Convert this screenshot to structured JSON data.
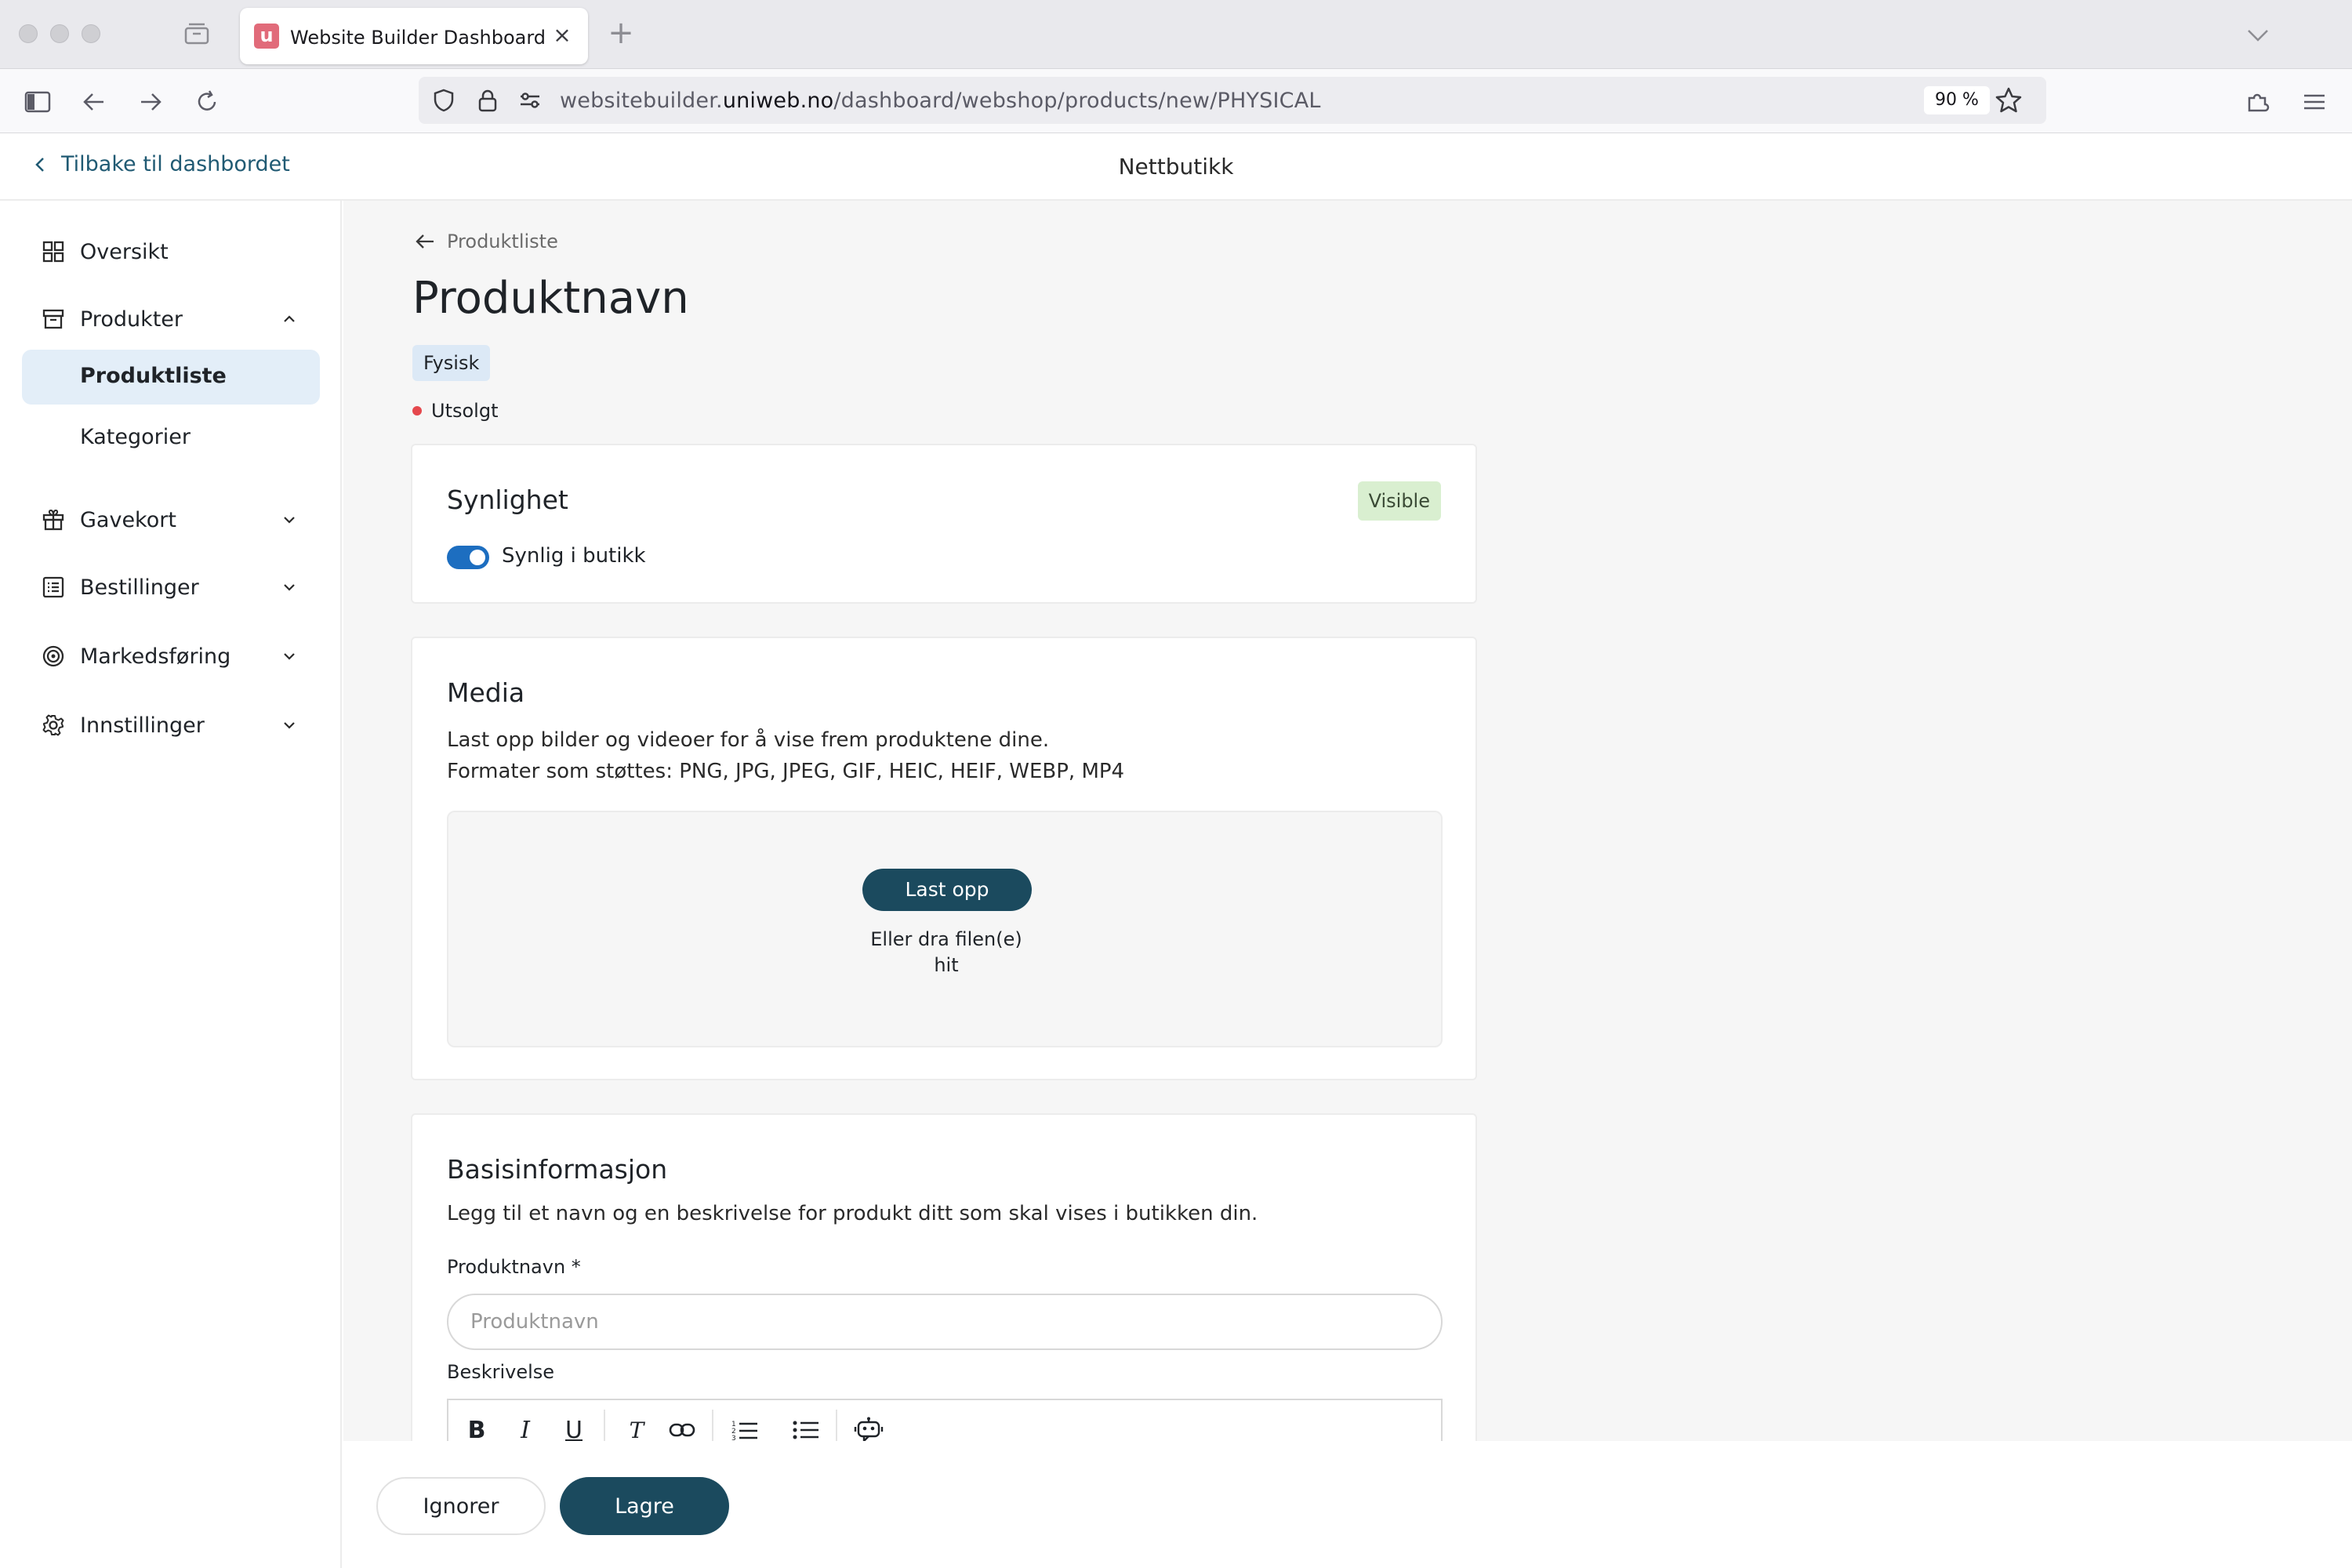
{
  "browser": {
    "tab_title": "Website Builder Dashboard",
    "favicon_letter": "u",
    "tab_close": "×",
    "new_tab": "+",
    "url_prefix": "websitebuilder.",
    "url_domain": "uniweb.no",
    "url_path": "/dashboard/webshop/products/new/PHYSICAL",
    "zoom": "90 %"
  },
  "header": {
    "back_label": "Tilbake til dashbordet",
    "title": "Nettbutikk"
  },
  "sidebar": {
    "items": [
      {
        "label": "Oversikt",
        "icon": "grid-icon"
      },
      {
        "label": "Produkter",
        "icon": "archive-box-icon",
        "expanded": true
      },
      {
        "label": "Gavekort",
        "icon": "gift-icon"
      },
      {
        "label": "Bestillinger",
        "icon": "list-icon"
      },
      {
        "label": "Markedsføring",
        "icon": "target-icon"
      },
      {
        "label": "Innstillinger",
        "icon": "gear-icon"
      }
    ],
    "subitems": [
      {
        "label": "Produktliste",
        "active": true
      },
      {
        "label": "Kategorier",
        "active": false
      }
    ]
  },
  "page": {
    "breadcrumb": "Produktliste",
    "title": "Produktnavn",
    "type_badge": "Fysisk",
    "status": "Utsolgt"
  },
  "visibility": {
    "title": "Synlighet",
    "badge": "Visible",
    "toggle_label": "Synlig i butikk",
    "toggle_on": true
  },
  "media": {
    "title": "Media",
    "line1": "Last opp bilder og videoer for å vise frem produktene dine.",
    "line2": "Formater som støttes: PNG, JPG, JPEG, GIF, HEIC, HEIF, WEBP, MP4",
    "upload_label": "Last opp",
    "drop_hint": "Eller dra filen(e) hit"
  },
  "basic": {
    "title": "Basisinformasjon",
    "description": "Legg til et navn og en beskrivelse for produkt ditt som skal vises i butikken din.",
    "name_label": "Produktnavn *",
    "name_placeholder": "Produktnavn",
    "desc_label": "Beskrivelse",
    "toolbar": {
      "bold": "B",
      "italic": "I",
      "underline": "U",
      "clear": "T"
    }
  },
  "footer": {
    "ignore_label": "Ignorer",
    "save_label": "Lagre"
  },
  "colors": {
    "primary": "#1b4a5e",
    "link": "#205a73",
    "active_bg": "#e3eef8",
    "toggle": "#1d6ec0",
    "status_red": "#e5484d",
    "visible_bg": "#d9efd0"
  }
}
